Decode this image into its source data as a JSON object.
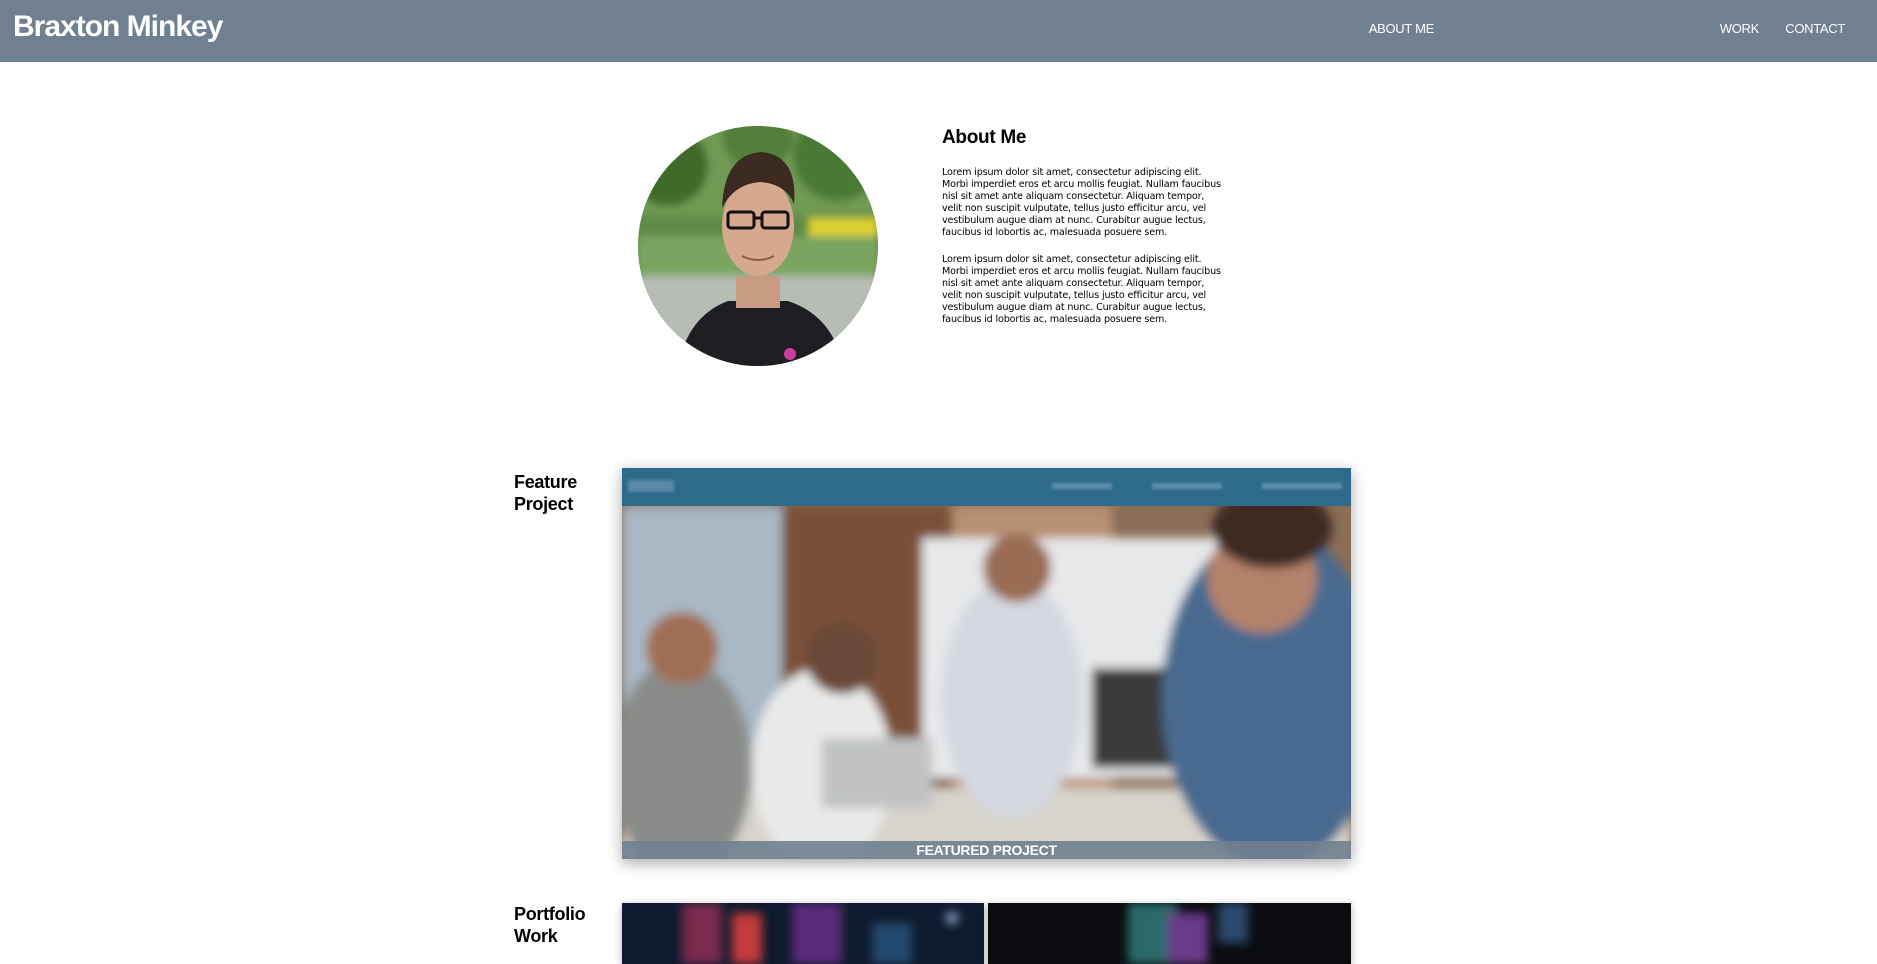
{
  "header": {
    "site_title": "Braxton Minkey",
    "nav": [
      {
        "label": "ABOUT ME"
      },
      {
        "label": "WORK"
      },
      {
        "label": "CONTACT"
      }
    ],
    "background_color": "#708090"
  },
  "about": {
    "heading": "About Me",
    "paragraphs": [
      "Lorem ipsum dolor sit amet, consectetur adipiscing elit. Morbi imperdiet eros et arcu mollis feugiat. Nullam faucibus nisl sit amet ante aliquam consectetur. Aliquam tempor, velit non suscipit vulputate, tellus justo efficitur arcu, vel vestibulum augue diam at nunc. Curabitur augue lectus, faucibus id lobortis ac, malesuada posuere sem.",
      "Lorem ipsum dolor sit amet, consectetur adipiscing elit. Morbi imperdiet eros et arcu mollis feugiat. Nullam faucibus nisl sit amet ante aliquam consectetur. Aliquam tempor, velit non suscipit vulputate, tellus justo efficitur arcu, vel vestibulum augue diam at nunc. Curabitur augue lectus, faucibus id lobortis ac, malesuada posuere sem."
    ]
  },
  "featured": {
    "label": "Feature Project",
    "caption": "FEATURED PROJECT"
  },
  "portfolio": {
    "label": "Portfolio Work"
  }
}
